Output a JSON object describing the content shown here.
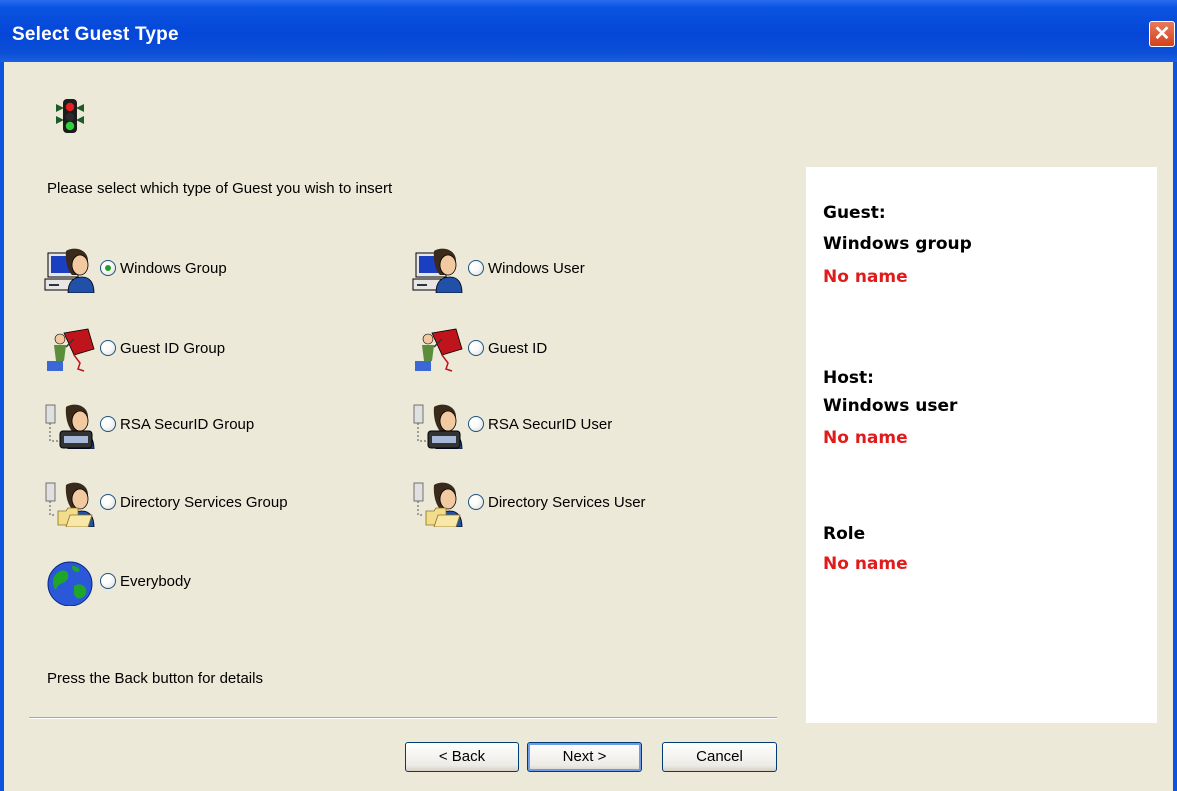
{
  "window": {
    "title": "Select Guest Type",
    "close_glyph": "✕"
  },
  "prompt": "Please select which type of Guest you wish to insert",
  "options": [
    {
      "label": "Windows Group",
      "icon": "windows-group-icon",
      "checked": true
    },
    {
      "label": "Windows User",
      "icon": "windows-user-icon",
      "checked": false
    },
    {
      "label": "Guest ID Group",
      "icon": "guest-id-group-icon",
      "checked": false
    },
    {
      "label": "Guest ID",
      "icon": "guest-id-icon",
      "checked": false
    },
    {
      "label": "RSA SecurID Group",
      "icon": "rsa-securid-group-icon",
      "checked": false
    },
    {
      "label": "RSA SecurID User",
      "icon": "rsa-securid-user-icon",
      "checked": false
    },
    {
      "label": "Directory Services Group",
      "icon": "directory-services-group-icon",
      "checked": false
    },
    {
      "label": "Directory Services User",
      "icon": "directory-services-user-icon",
      "checked": false
    },
    {
      "label": "Everybody",
      "icon": "globe-icon",
      "checked": false
    }
  ],
  "hint": "Press the Back button for details",
  "buttons": {
    "back": "< Back",
    "next": "Next >",
    "cancel": "Cancel"
  },
  "summary": {
    "guest_heading": "Guest:",
    "guest_type": "Windows group",
    "guest_name": "No name",
    "host_heading": "Host:",
    "host_type": "Windows user",
    "host_name": "No name",
    "role_heading": "Role",
    "role_name": "No name"
  },
  "colors": {
    "titlebar": "#0A54E0",
    "accent_red": "#E01B1B",
    "radio_dot": "#21A121"
  }
}
